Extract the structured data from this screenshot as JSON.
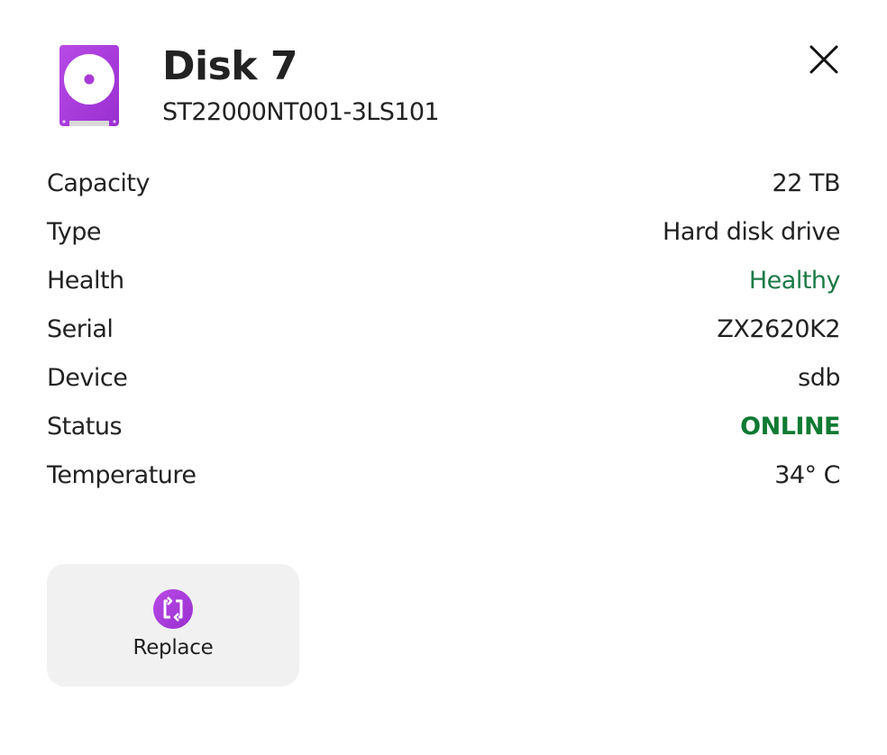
{
  "disk": {
    "title": "Disk 7",
    "model": "ST22000NT001-3LS101",
    "icon": "hard-disk-icon"
  },
  "colors": {
    "accent": "#a93ad8",
    "healthy": "#1a7a45",
    "online": "#0f7a32",
    "button_bg": "#f1f1f1"
  },
  "details": [
    {
      "label": "Capacity",
      "value": "22 TB"
    },
    {
      "label": "Type",
      "value": "Hard disk drive"
    },
    {
      "label": "Health",
      "value": "Healthy"
    },
    {
      "label": "Serial",
      "value": "ZX2620K2"
    },
    {
      "label": "Device",
      "value": "sdb"
    },
    {
      "label": "Status",
      "value": "ONLINE"
    },
    {
      "label": "Temperature",
      "value": "34° C"
    }
  ],
  "actions": {
    "replace_label": "Replace",
    "replace_icon": "replace-icon",
    "close_icon": "close-icon"
  }
}
